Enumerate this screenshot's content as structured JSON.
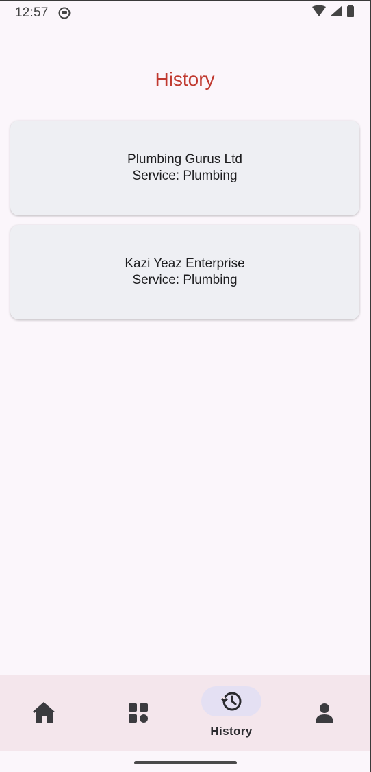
{
  "status_bar": {
    "time": "12:57",
    "icons": [
      "app-notification-icon",
      "wifi-icon",
      "signal-icon",
      "battery-icon"
    ]
  },
  "page": {
    "title": "History"
  },
  "history": [
    {
      "provider": "Plumbing Gurus Ltd",
      "service": "Service: Plumbing"
    },
    {
      "provider": "Kazi Yeaz Enterprise",
      "service": "Service: Plumbing"
    }
  ],
  "bottom_nav": {
    "items": [
      {
        "icon": "home-icon",
        "label": ""
      },
      {
        "icon": "grid-icon",
        "label": ""
      },
      {
        "icon": "history-icon",
        "label": "History",
        "selected": true
      },
      {
        "icon": "person-icon",
        "label": ""
      }
    ]
  },
  "colors": {
    "title": "#c0392f",
    "background": "#fbf6fb",
    "card": "#eeeff3",
    "nav_background": "#f4e6ec",
    "nav_pill": "#e4e0f3"
  }
}
